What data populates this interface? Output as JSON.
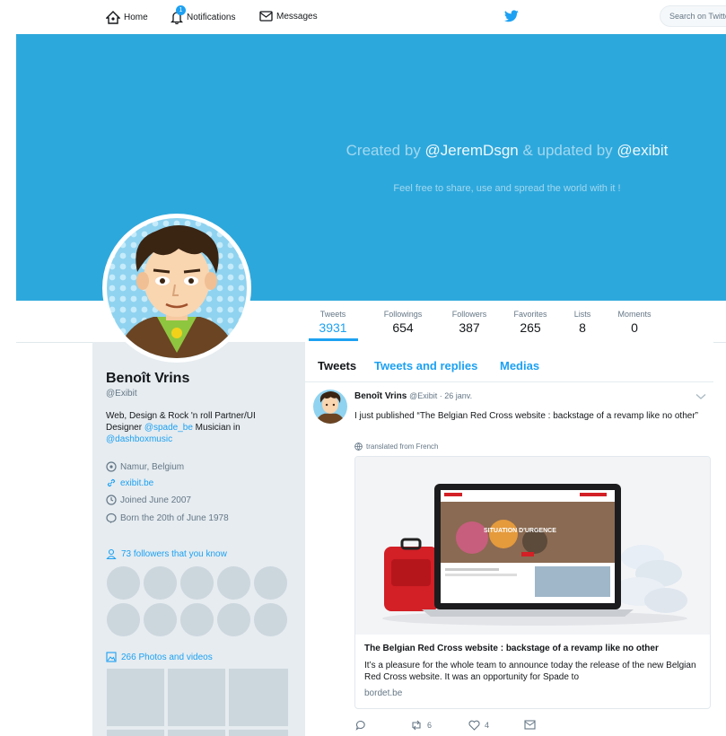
{
  "nav": {
    "home": "Home",
    "notifications": "Notifications",
    "notifications_badge": "1",
    "messages": "Messages",
    "search_placeholder": "Search on Twitter"
  },
  "banner": {
    "title_prefix": "Created by ",
    "title_user1": "@JeremDsgn",
    "title_mid": " & updated by ",
    "title_user2": "@exibit",
    "subtitle": "Feel free to share, use and spread the world with it !"
  },
  "stats": [
    {
      "label": "Tweets",
      "value": "3931"
    },
    {
      "label": "Followings",
      "value": "654"
    },
    {
      "label": "Followers",
      "value": "387"
    },
    {
      "label": "Favorites",
      "value": "265"
    },
    {
      "label": "Lists",
      "value": "8"
    },
    {
      "label": "Moments",
      "value": "0"
    }
  ],
  "profile": {
    "name": "Benoît Vrins",
    "handle": "@Exibit",
    "bio_1": "Web, Design & Rock 'n roll Partner/UI Designer ",
    "bio_link1": "@spade_be",
    "bio_2": " Musician in ",
    "bio_link2": "@dashboxmusic",
    "location": "Namur, Belgium",
    "website": "exibit.be",
    "joined": "Joined June 2007",
    "born": "Born the 20th of June 1978",
    "followers_known": "73 followers that you know",
    "photos": "266 Photos and videos"
  },
  "tabs": {
    "tweets": "Tweets",
    "replies": "Tweets and replies",
    "medias": "Medias"
  },
  "tweet": {
    "name": "Benoît Vrins",
    "handle": "@Exibit · 26 janv.",
    "text": "I just published “The Belgian Red Cross website : backstage of a revamp like no other”",
    "translated": "translated from French",
    "card_title": "The Belgian Red Cross website : backstage of a revamp like no other",
    "card_desc": "It’s a pleasure for the whole team to announce today the release of the new Belgian Red Cross website. It was an opportunity for Spade to",
    "card_domain": "bordet.be",
    "card_image_headline": "SITUATION D'URGENCE",
    "retweets": "6",
    "likes": "4"
  },
  "colors": {
    "accent": "#1da1f2",
    "banner": "#2da8dc",
    "sidebar_bg": "#e6ecf0"
  }
}
